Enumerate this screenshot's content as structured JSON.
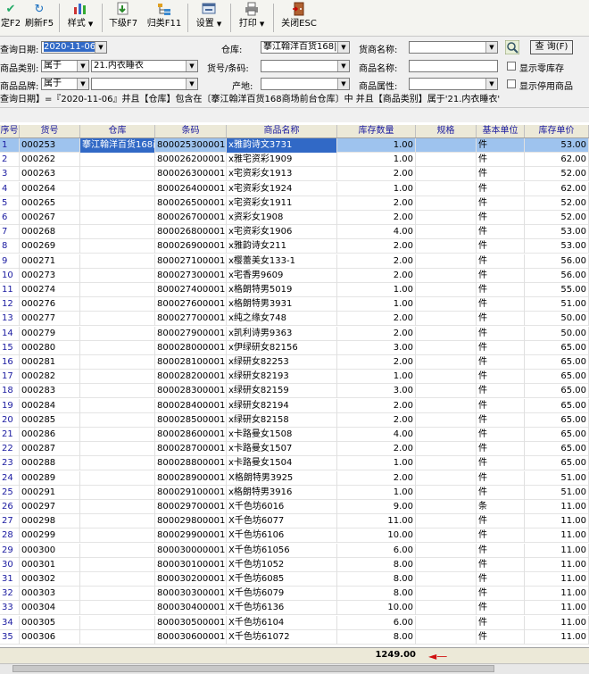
{
  "toolbar": {
    "items": [
      {
        "label": "定F2",
        "icon": "confirm-icon"
      },
      {
        "label": "刷新F5",
        "icon": "refresh-icon"
      },
      {
        "label": "样式",
        "icon": "chart-icon"
      },
      {
        "label": "下级F7",
        "icon": "down-level-icon"
      },
      {
        "label": "归类F11",
        "icon": "classify-icon"
      },
      {
        "label": "设置",
        "icon": "settings-icon"
      },
      {
        "label": "打印",
        "icon": "printer-icon"
      },
      {
        "label": "关闭ESC",
        "icon": "close-icon"
      }
    ]
  },
  "filters": {
    "date_label": "查询日期:",
    "date_value": "2020-11-06",
    "category_label": "商品类别:",
    "category_op": "属于",
    "category_value": "21.内衣睡衣",
    "brand_label": "商品品牌:",
    "brand_op": "属于",
    "warehouse_label": "仓库:",
    "warehouse_value": "搴江翰洋百货168|",
    "sku_label": "货号/条码:",
    "origin_label": "产地:",
    "supplier_label": "货商名称:",
    "name_label": "商品名称:",
    "attr_label": "商品属性:",
    "query_button": "查 询(F)",
    "show_zero_label": "显示零库存",
    "show_disabled_label": "显示停用商品"
  },
  "condition_text": "查询日期】=『2020-11-06』并且【仓库】包含在〔搴江翰洋百货168商场前台仓库〕中 并且【商品类别】属于'21.内衣睡衣'",
  "columns": {
    "no": "序号",
    "sku": "货号",
    "warehouse": "仓库",
    "barcode": "条码",
    "name": "商品名称",
    "qty": "库存数量",
    "spec": "规格",
    "unit": "基本单位",
    "price": "库存单价"
  },
  "rows": [
    {
      "no": "1",
      "sku": "000253",
      "warehouse": "搴江翰洋百货168商",
      "barcode": "8000253000019",
      "name": "x雅韵诗文3731",
      "qty": "1.00",
      "spec": "",
      "unit": "件",
      "price": "53.00"
    },
    {
      "no": "2",
      "sku": "000262",
      "warehouse": "",
      "barcode": "8000262000017",
      "name": "x雅宅资彩1909",
      "qty": "1.00",
      "spec": "",
      "unit": "件",
      "price": "62.00"
    },
    {
      "no": "3",
      "sku": "000263",
      "warehouse": "",
      "barcode": "8000263000016",
      "name": "x宅资彩女1913",
      "qty": "2.00",
      "spec": "",
      "unit": "件",
      "price": "52.00"
    },
    {
      "no": "4",
      "sku": "000264",
      "warehouse": "",
      "barcode": "8000264000015",
      "name": "x宅资彩女1924",
      "qty": "1.00",
      "spec": "",
      "unit": "件",
      "price": "62.00"
    },
    {
      "no": "5",
      "sku": "000265",
      "warehouse": "",
      "barcode": "8000265000014",
      "name": "x宅资彩女1911",
      "qty": "2.00",
      "spec": "",
      "unit": "件",
      "price": "52.00"
    },
    {
      "no": "6",
      "sku": "000267",
      "warehouse": "",
      "barcode": "8000267000012",
      "name": "x资彩女1908",
      "qty": "2.00",
      "spec": "",
      "unit": "件",
      "price": "52.00"
    },
    {
      "no": "7",
      "sku": "000268",
      "warehouse": "",
      "barcode": "8000268000011",
      "name": "x宅资彩女1906",
      "qty": "4.00",
      "spec": "",
      "unit": "件",
      "price": "53.00"
    },
    {
      "no": "8",
      "sku": "000269",
      "warehouse": "",
      "barcode": "8000269000010",
      "name": "x雅韵诗女211",
      "qty": "2.00",
      "spec": "",
      "unit": "件",
      "price": "53.00"
    },
    {
      "no": "9",
      "sku": "000271",
      "warehouse": "",
      "barcode": "8000271000015",
      "name": "x樱蕾美女133-1",
      "qty": "2.00",
      "spec": "",
      "unit": "件",
      "price": "56.00"
    },
    {
      "no": "10",
      "sku": "000273",
      "warehouse": "",
      "barcode": "8000273000013",
      "name": "x宅香男9609",
      "qty": "2.00",
      "spec": "",
      "unit": "件",
      "price": "56.00"
    },
    {
      "no": "11",
      "sku": "000274",
      "warehouse": "",
      "barcode": "8000274000012",
      "name": "x格朗特男5019",
      "qty": "1.00",
      "spec": "",
      "unit": "件",
      "price": "55.00"
    },
    {
      "no": "12",
      "sku": "000276",
      "warehouse": "",
      "barcode": "8000276000010",
      "name": "x格朗特男3931",
      "qty": "1.00",
      "spec": "",
      "unit": "件",
      "price": "51.00"
    },
    {
      "no": "13",
      "sku": "000277",
      "warehouse": "",
      "barcode": "8000277000019",
      "name": "x纯之缘女748",
      "qty": "2.00",
      "spec": "",
      "unit": "件",
      "price": "50.00"
    },
    {
      "no": "14",
      "sku": "000279",
      "warehouse": "",
      "barcode": "8000279000017",
      "name": "x凯利诗男9363",
      "qty": "2.00",
      "spec": "",
      "unit": "件",
      "price": "50.00"
    },
    {
      "no": "15",
      "sku": "000280",
      "warehouse": "",
      "barcode": "8000280000013",
      "name": "x伊绿研女82156",
      "qty": "3.00",
      "spec": "",
      "unit": "件",
      "price": "65.00"
    },
    {
      "no": "16",
      "sku": "000281",
      "warehouse": "",
      "barcode": "8000281000012",
      "name": "x绿研女82253",
      "qty": "2.00",
      "spec": "",
      "unit": "件",
      "price": "65.00"
    },
    {
      "no": "17",
      "sku": "000282",
      "warehouse": "",
      "barcode": "8000282000011",
      "name": "x绿研女82193",
      "qty": "1.00",
      "spec": "",
      "unit": "件",
      "price": "65.00"
    },
    {
      "no": "18",
      "sku": "000283",
      "warehouse": "",
      "barcode": "8000283000010",
      "name": "x绿研女82159",
      "qty": "3.00",
      "spec": "",
      "unit": "件",
      "price": "65.00"
    },
    {
      "no": "19",
      "sku": "000284",
      "warehouse": "",
      "barcode": "8000284000019",
      "name": "x绿研女82194",
      "qty": "2.00",
      "spec": "",
      "unit": "件",
      "price": "65.00"
    },
    {
      "no": "20",
      "sku": "000285",
      "warehouse": "",
      "barcode": "8000285000018",
      "name": "x绿研女82158",
      "qty": "2.00",
      "spec": "",
      "unit": "件",
      "price": "65.00"
    },
    {
      "no": "21",
      "sku": "000286",
      "warehouse": "",
      "barcode": "8000286000017",
      "name": "x卡路曼女1508",
      "qty": "4.00",
      "spec": "",
      "unit": "件",
      "price": "65.00"
    },
    {
      "no": "22",
      "sku": "000287",
      "warehouse": "",
      "barcode": "8000287000016",
      "name": "x卡路曼女1507",
      "qty": "2.00",
      "spec": "",
      "unit": "件",
      "price": "65.00"
    },
    {
      "no": "23",
      "sku": "000288",
      "warehouse": "",
      "barcode": "8000288000015",
      "name": "x卡路曼女1504",
      "qty": "1.00",
      "spec": "",
      "unit": "件",
      "price": "65.00"
    },
    {
      "no": "24",
      "sku": "000289",
      "warehouse": "",
      "barcode": "8000289000014",
      "name": "X格朗特男3925",
      "qty": "2.00",
      "spec": "",
      "unit": "件",
      "price": "51.00"
    },
    {
      "no": "25",
      "sku": "000291",
      "warehouse": "",
      "barcode": "8000291000019",
      "name": "x格朗特男3916",
      "qty": "1.00",
      "spec": "",
      "unit": "件",
      "price": "51.00"
    },
    {
      "no": "26",
      "sku": "000297",
      "warehouse": "",
      "barcode": "8000297000013",
      "name": "X千色坊6016",
      "qty": "9.00",
      "spec": "",
      "unit": "条",
      "price": "11.00"
    },
    {
      "no": "27",
      "sku": "000298",
      "warehouse": "",
      "barcode": "8000298000012",
      "name": "X千色坊6077",
      "qty": "11.00",
      "spec": "",
      "unit": "件",
      "price": "11.00"
    },
    {
      "no": "28",
      "sku": "000299",
      "warehouse": "",
      "barcode": "8000299000011",
      "name": "X千色坊6106",
      "qty": "10.00",
      "spec": "",
      "unit": "件",
      "price": "11.00"
    },
    {
      "no": "29",
      "sku": "000300",
      "warehouse": "",
      "barcode": "8000300000016",
      "name": "X千色坊61056",
      "qty": "6.00",
      "spec": "",
      "unit": "件",
      "price": "11.00"
    },
    {
      "no": "30",
      "sku": "000301",
      "warehouse": "",
      "barcode": "8000301000015",
      "name": "X千色坊1052",
      "qty": "8.00",
      "spec": "",
      "unit": "件",
      "price": "11.00"
    },
    {
      "no": "31",
      "sku": "000302",
      "warehouse": "",
      "barcode": "8000302000014",
      "name": "X千色坊6085",
      "qty": "8.00",
      "spec": "",
      "unit": "件",
      "price": "11.00"
    },
    {
      "no": "32",
      "sku": "000303",
      "warehouse": "",
      "barcode": "8000303000013",
      "name": "X千色坊6079",
      "qty": "8.00",
      "spec": "",
      "unit": "件",
      "price": "11.00"
    },
    {
      "no": "33",
      "sku": "000304",
      "warehouse": "",
      "barcode": "8000304000012",
      "name": "X千色坊6136",
      "qty": "10.00",
      "spec": "",
      "unit": "件",
      "price": "11.00"
    },
    {
      "no": "34",
      "sku": "000305",
      "warehouse": "",
      "barcode": "8000305000011",
      "name": "X千色坊6104",
      "qty": "6.00",
      "spec": "",
      "unit": "件",
      "price": "11.00"
    },
    {
      "no": "35",
      "sku": "000306",
      "warehouse": "",
      "barcode": "8000306000010",
      "name": "X千色坊61072",
      "qty": "8.00",
      "spec": "",
      "unit": "件",
      "price": "11.00"
    }
  ],
  "total_qty": "1249.00"
}
